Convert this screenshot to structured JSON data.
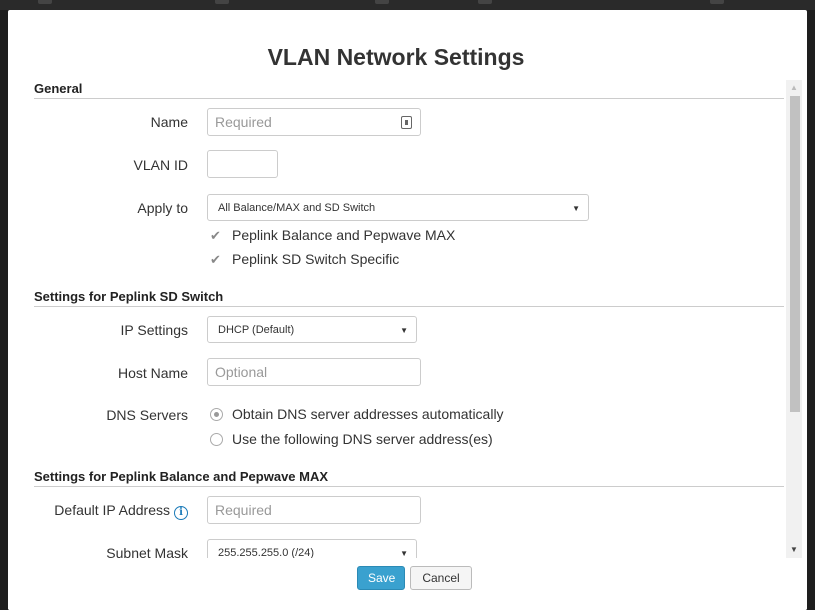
{
  "dialog": {
    "title": "VLAN Network Settings"
  },
  "sections": {
    "general": "General",
    "sd_switch": "Settings for Peplink SD Switch",
    "balance": "Settings for Peplink Balance and Pepwave MAX"
  },
  "general": {
    "name_label": "Name",
    "name_placeholder": "Required",
    "vlan_label": "VLAN ID",
    "vlan_value": "",
    "apply_label": "Apply to",
    "apply_value": "All Balance/MAX and SD Switch",
    "check_balance": "Peplink Balance and Pepwave MAX",
    "check_sd": "Peplink SD Switch Specific"
  },
  "sd_switch": {
    "ip_label": "IP Settings",
    "ip_value": "DHCP (Default)",
    "host_label": "Host Name",
    "host_placeholder": "Optional",
    "dns_label": "DNS Servers",
    "dns_auto": "Obtain DNS server addresses automatically",
    "dns_manual": "Use the following DNS server address(es)"
  },
  "balance": {
    "ip_label": "Default IP Address",
    "ip_placeholder": "Required",
    "subnet_label": "Subnet Mask",
    "subnet_value": "255.255.255.0 (/24)"
  },
  "footer": {
    "save": "Save",
    "cancel": "Cancel"
  },
  "icons": {
    "check": "✔",
    "caret": "▼",
    "info": "i",
    "scroll_up": "▲",
    "scroll_down": "▼"
  },
  "colors": {
    "primary": "#3aa1cf",
    "info": "#1a7ab8"
  }
}
